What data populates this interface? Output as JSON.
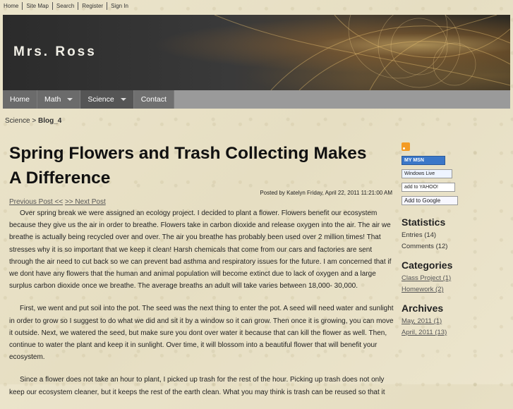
{
  "toplinks": [
    "Home",
    "Site Map",
    "Search",
    "Register",
    "Sign In"
  ],
  "header": {
    "title": "Mrs. Ross"
  },
  "nav": {
    "home": "Home",
    "math": "Math",
    "science": "Science",
    "contact": "Contact"
  },
  "breadcrumb": {
    "parent": "Science",
    "sep": ">",
    "current": "Blog_4"
  },
  "post": {
    "title": "Spring Flowers and Trash Collecting Makes A Difference",
    "posted_by": "Posted by Katelyn Friday, April 22, 2011 11:21:00 AM",
    "prev": "Previous Post <<",
    "next": ">> Next Post",
    "paragraphs": [
      "Over spring break we were assigned an ecology project. I decided to plant a flower. Flowers benefit our ecosystem because they give us the air in order to breathe. Flowers take in carbon dioxide and release oxygen into the air. The air we breathe is actually being recycled over and over. The air you breathe has probably been used over 2 million times! That stresses why it is so important that we keep it clean! Harsh chemicals that come from our cars and factories are sent through the air need to cut back so we can prevent bad asthma and respiratory issues for the future. I am concerned that if we dont have any flowers that the human and animal population will become extinct due to lack of oxygen and a large surplus carbon dioxide once we breathe. The average breaths an adult will take varies between 18,000- 30,000.",
      "First, we went and put soil into the pot. The seed was the next thing to enter the pot. A seed will need water and sunlight in order to grow so I suggest to do what we did and sit it by a window so it can grow. Then once it is growing, you can move it outside. Next, we watered the seed, but make sure you dont over water it because that can kill the flower as well. Then, continue to water the plant and keep it in sunlight. Over time,  it will blossom into a beautiful flower that will benefit your ecosystem.",
      "Since a flower does not take an hour to plant, I picked up trash for the rest of the hour. Picking up trash does not only keep our ecosystem cleaner, but it keeps the rest of the earth clean. What you may think is trash can be reused so that it"
    ]
  },
  "sidebar": {
    "badges": {
      "msn": "MY MSN",
      "live": "Windows Live",
      "yahoo": "add to YAHOO!",
      "google": "Add to Google"
    },
    "statistics": {
      "heading": "Statistics",
      "entries": "Entries (14)",
      "comments": "Comments (12)"
    },
    "categories": {
      "heading": "Categories",
      "items": [
        "Class Project (1)",
        "Homework (2)"
      ]
    },
    "archives": {
      "heading": "Archives",
      "items": [
        "May, 2011 (1)",
        "April, 2011 (13)"
      ]
    }
  },
  "colors": {
    "nav_bg": "#9a9a9a",
    "page_bg": "#e9e2c9",
    "header_bg": "#333333"
  }
}
